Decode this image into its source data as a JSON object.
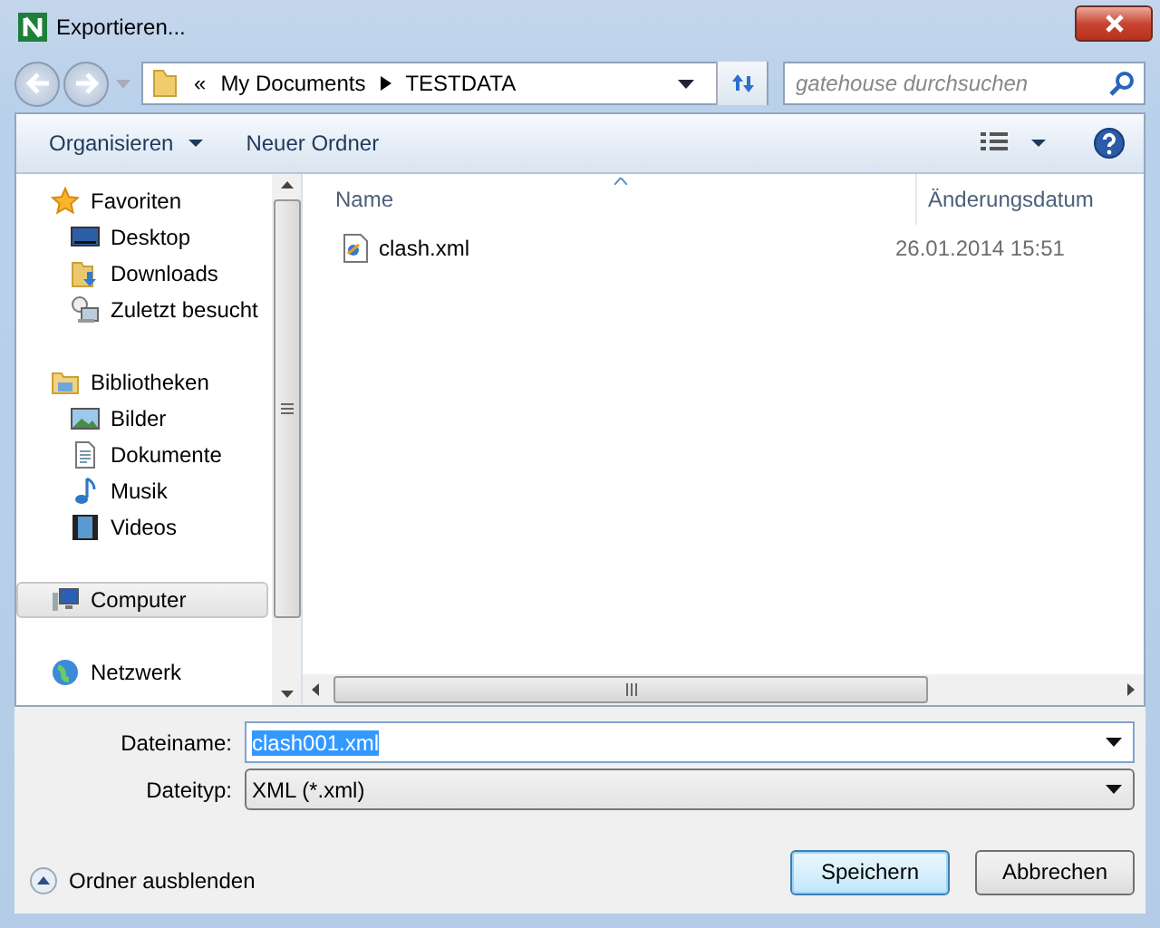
{
  "window": {
    "title": "Exportieren..."
  },
  "address": {
    "overflow_marker": "«",
    "path": [
      "My Documents",
      "TESTDATA"
    ]
  },
  "search": {
    "placeholder": "gatehouse durchsuchen"
  },
  "toolbar": {
    "buttons": [
      {
        "label": "Organisieren",
        "dropdown": true
      },
      {
        "label": "Neuer Ordner",
        "dropdown": false
      }
    ]
  },
  "sidebar": {
    "groups": [
      {
        "label": "Favoriten",
        "selected": false,
        "children": [
          {
            "label": "Desktop",
            "selected": false
          },
          {
            "label": "Downloads",
            "selected": false
          },
          {
            "label": "Zuletzt besucht",
            "selected": false
          }
        ]
      },
      {
        "label": "Bibliotheken",
        "selected": false,
        "children": [
          {
            "label": "Bilder",
            "selected": false
          },
          {
            "label": "Dokumente",
            "selected": false
          },
          {
            "label": "Musik",
            "selected": false
          },
          {
            "label": "Videos",
            "selected": false
          }
        ]
      },
      {
        "label": "Computer",
        "selected": true
      },
      {
        "label": "Netzwerk",
        "selected": false
      }
    ]
  },
  "file_list": {
    "columns": [
      "Name",
      "Änderungsdatum"
    ],
    "rows": [
      {
        "name": "clash.xml",
        "modified": "26.01.2014 15:51",
        "selected": false
      }
    ]
  },
  "form": {
    "filename_label": "Dateiname:",
    "filename": "clash001.xml",
    "filename_selected": true,
    "filetype_label": "Dateityp:",
    "filetype": "XML (*.xml)"
  },
  "hide_folders": "Ordner ausblenden",
  "buttons": [
    {
      "label": "Speichern",
      "default": true
    },
    {
      "label": "Abbrechen",
      "default": false
    }
  ]
}
